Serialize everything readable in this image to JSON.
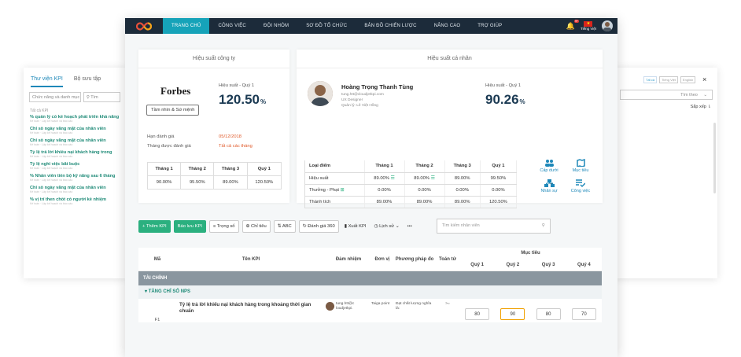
{
  "left_panel": {
    "tabs": [
      "Thư viện KPI",
      "Bộ sưu tập"
    ],
    "select_placeholder": "Chức năng và danh mục",
    "search_placeholder": "Tìm",
    "header": "Tất cả KPI",
    "items": [
      {
        "title": "% quản lý có kế hoạch phát triển khả năng",
        "sub": "Kế toán · Lập kế hoạch và báo cáo"
      },
      {
        "title": "Chỉ số ngày vắng mặt của nhân viên",
        "sub": "Kế toán · Lập kế hoạch và báo cáo"
      },
      {
        "title": "Chỉ số ngày vắng mặt của nhân viên",
        "sub": "Kế toán · Lập kế hoạch và báo cáo"
      },
      {
        "title": "Tỷ lệ trả lời khiếu nại khách hàng trong",
        "sub": "Kế toán · Lập kế hoạch và báo cáo"
      },
      {
        "title": "Tỷ lệ nghỉ việc bắt buộc",
        "sub": "Kế toán · Lập kế hoạch và báo cáo"
      },
      {
        "title": "% Nhân viên tiến bộ kỹ năng sau 6 tháng",
        "sub": "Kế toán · Lập kế hoạch và báo cáo"
      },
      {
        "title": "Chỉ số ngày vắng mặt của nhân viên",
        "sub": "Kế toán · Lập kế hoạch và báo cáo"
      },
      {
        "title": "% vị trí then chốt có người kế nhiệm",
        "sub": "Kế toán · Lập kế hoạch và báo cáo"
      }
    ]
  },
  "right_panel": {
    "filters": [
      "Tất cả",
      "Tiếng Việt",
      "English"
    ],
    "close": "×",
    "search_label": "Tìm theo",
    "sort_label": "Sắp xếp"
  },
  "nav": {
    "items": [
      "TRANG CHỦ",
      "CÔNG VIỆC",
      "ĐỘI NHÓM",
      "SƠ ĐỒ TỔ CHỨC",
      "BẢN ĐỒ CHIẾN LƯỢC",
      "NÂNG CAO",
      "TRỢ GIÚP"
    ],
    "active": 0,
    "badge": "9+",
    "lang": "Tiếng Việt"
  },
  "company": {
    "title": "Hiệu suất công ty",
    "brand": "Forbes",
    "vision_btn": "Tầm nhìn & Sứ mệnh",
    "perf_label": "Hiệu suất - Quý 1",
    "perf_value": "120.50",
    "pct": "%",
    "deadline_label": "Hạn đánh giá",
    "deadline_value": "05/12/2018",
    "evaluated_label": "Tháng được đánh giá",
    "evaluated_value": "Tất cả các tháng",
    "table": {
      "headers": [
        "Tháng 1",
        "Tháng 2",
        "Tháng 3",
        "Quý 1"
      ],
      "values": [
        "90.00%",
        "95.50%",
        "89.00%",
        "120.50%"
      ]
    }
  },
  "personal": {
    "title": "Hiệu suất cá nhân",
    "name": "Hoàng Trọng Thanh Tùng",
    "email": "tung.htt@cloudjetkpi.com",
    "role": "UX Designer",
    "manager": "Quản lý: Lê Việt Hồng",
    "perf_label": "Hiệu suất - Quý 1",
    "perf_value": "90.26",
    "pct": "%",
    "table": {
      "headers": [
        "Loại điểm",
        "Tháng 1",
        "Tháng 2",
        "Tháng 3",
        "Quý 1"
      ],
      "rows": [
        [
          "Hiệu suất",
          "89.00%",
          "89.00%",
          "89.00%",
          "99.50%"
        ],
        [
          "Thưởng - Phạt",
          "0.00%",
          "0.00%",
          "0.00%",
          "0.00%"
        ],
        [
          "Thành tích",
          "89.00%",
          "89.00%",
          "89.00%",
          "120.50%"
        ]
      ]
    },
    "shortcuts": [
      "Cấp dưới",
      "Mục tiêu",
      "Nhân sự",
      "Công việc"
    ]
  },
  "toolbar": {
    "add": "+ Thêm KPI",
    "report": "Báo lưu KPI",
    "weight": "Trọng số",
    "target": "Chỉ tiêu",
    "abc": "ABC",
    "eval360": "Đánh giá 360",
    "export": "Xuất KPI",
    "history": "Lịch sử",
    "more": "•••",
    "search_placeholder": "Tìm kiếm nhân viên"
  },
  "kpi_table": {
    "headers": {
      "code": "Mã",
      "name": "Tên KPI",
      "owner": "Đảm nhiệm",
      "unit": "Đơn vị",
      "method": "Phương pháp đo",
      "op": "Toán tử",
      "target": "Mục tiêu",
      "quarters": [
        "Quý 1",
        "Quý 2",
        "Quý 3",
        "Quý 4"
      ]
    },
    "section": "TÀI CHÍNH",
    "group": "TĂNG CHỈ SỐ NPS",
    "row": {
      "code": "F1",
      "name": "Tỷ lệ trả lời khiếu nại khách hàng trong khoảng thời gian chuẩn",
      "owner": "tung.htt@c loudjetkpi.",
      "unit": "Taiga point",
      "method": "Đạt chất lượng nghĩa là:",
      "op": ">=",
      "values": [
        "80",
        "90",
        "80",
        "70"
      ]
    }
  }
}
